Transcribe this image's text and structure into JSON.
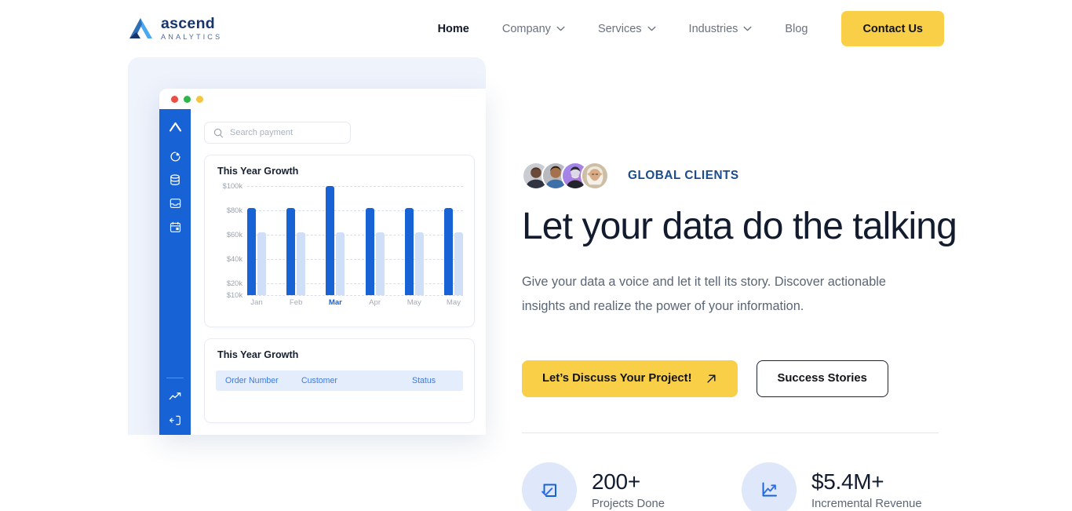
{
  "brand": {
    "name": "ascend",
    "tagline": "ANALYTICS"
  },
  "nav": {
    "items": [
      {
        "label": "Home",
        "active": true,
        "caret": false
      },
      {
        "label": "Company",
        "active": false,
        "caret": true
      },
      {
        "label": "Services",
        "active": false,
        "caret": true
      },
      {
        "label": "Industries",
        "active": false,
        "caret": true
      },
      {
        "label": "Blog",
        "active": false,
        "caret": false
      }
    ],
    "cta_label": "Contact Us",
    "cta_color": "#f8cf46"
  },
  "hero": {
    "eyebrow": "GLOBAL CLIENTS",
    "eyebrow_color": "#1b4c8c",
    "headline": "Let your data do the talking",
    "lede": "Give your data a voice and let it tell its story. Discover actionable insights and realize the power of your information.",
    "primary_button": "Let’s Discuss Your Project!",
    "secondary_button": "Success Stories",
    "avatar_count": 4
  },
  "stats": [
    {
      "value": "200+",
      "label": "Projects Done",
      "icon": "checked-square-icon"
    },
    {
      "value": "$5.4M+",
      "label": "Incremental Revenue",
      "icon": "trending-up-chart-icon"
    }
  ],
  "mockup": {
    "window_dots": [
      "#ec4d44",
      "#2eb648",
      "#f5c542"
    ],
    "search_placeholder": "Search payment",
    "sidebar_icons": [
      "logo-chevron-icon",
      "pie-chart-icon",
      "database-icon",
      "inbox-icon",
      "calendar-icon",
      "trending-up-icon",
      "logout-icon"
    ],
    "chart_card_title": "This Year Growth",
    "table_card_title": "This Year Growth",
    "table_headers": [
      "Order Number",
      "Customer",
      "Status"
    ],
    "accent_color": "#1763d6",
    "secondary_bar_color": "#cfdff7"
  },
  "chart_data": {
    "type": "bar",
    "title": "This Year Growth",
    "categories": [
      "Jan",
      "Feb",
      "Mar",
      "Apr",
      "May",
      "May"
    ],
    "highlighted_category": "Mar",
    "series": [
      {
        "name": "Primary",
        "color": "#1763d6",
        "values": [
          82,
          82,
          100,
          82,
          82,
          82
        ]
      },
      {
        "name": "Secondary",
        "color": "#cfdff7",
        "values": [
          62,
          62,
          62,
          62,
          62,
          62
        ]
      }
    ],
    "ylim": [
      10,
      100
    ],
    "yticks": [
      100,
      80,
      60,
      40,
      20,
      10
    ],
    "ytick_labels": [
      "$100k",
      "$80k",
      "$60k",
      "$40k",
      "$20k",
      "$10k"
    ],
    "xlabel": "",
    "ylabel": "",
    "grid": "horizontal-dashed",
    "legend": "none"
  }
}
